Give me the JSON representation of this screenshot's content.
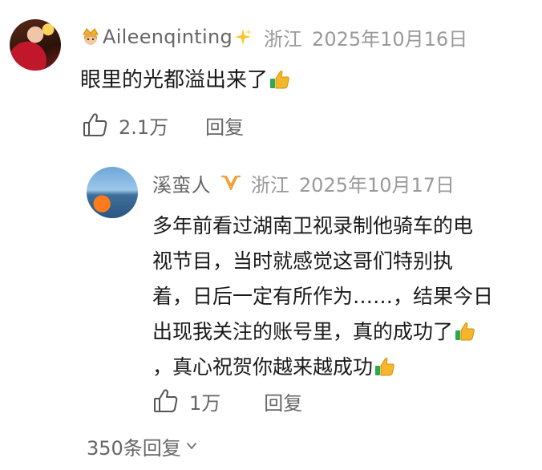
{
  "comment": {
    "username": "Aileenqinting",
    "location": "浙江",
    "date": "2025年10月16日",
    "text": "眼里的光都溢出来了",
    "likes": "2.1万",
    "reply_label": "回复"
  },
  "reply": {
    "username": "溪蛮人",
    "location": "浙江",
    "date": "2025年10月17日",
    "lines": [
      "多年前看过湖南卫视录制他骑车的电",
      "视节目，当时就感觉这哥们特别执",
      "着，日后一定有所作为……，结果今日",
      "出现我关注的账号里，真的成功了",
      "，真心祝贺你越来越成功"
    ],
    "likes": "1万",
    "reply_label": "回复"
  },
  "more_replies": "350条回复",
  "icons": {
    "crown": "princess-crown-icon",
    "sparkles": "sparkles-icon",
    "badge": "orange-v-badge-icon",
    "thumb_emoji": "thumbs-up-emoji-icon",
    "like": "thumbs-up-outline-icon",
    "chevron": "chevron-down-icon"
  }
}
